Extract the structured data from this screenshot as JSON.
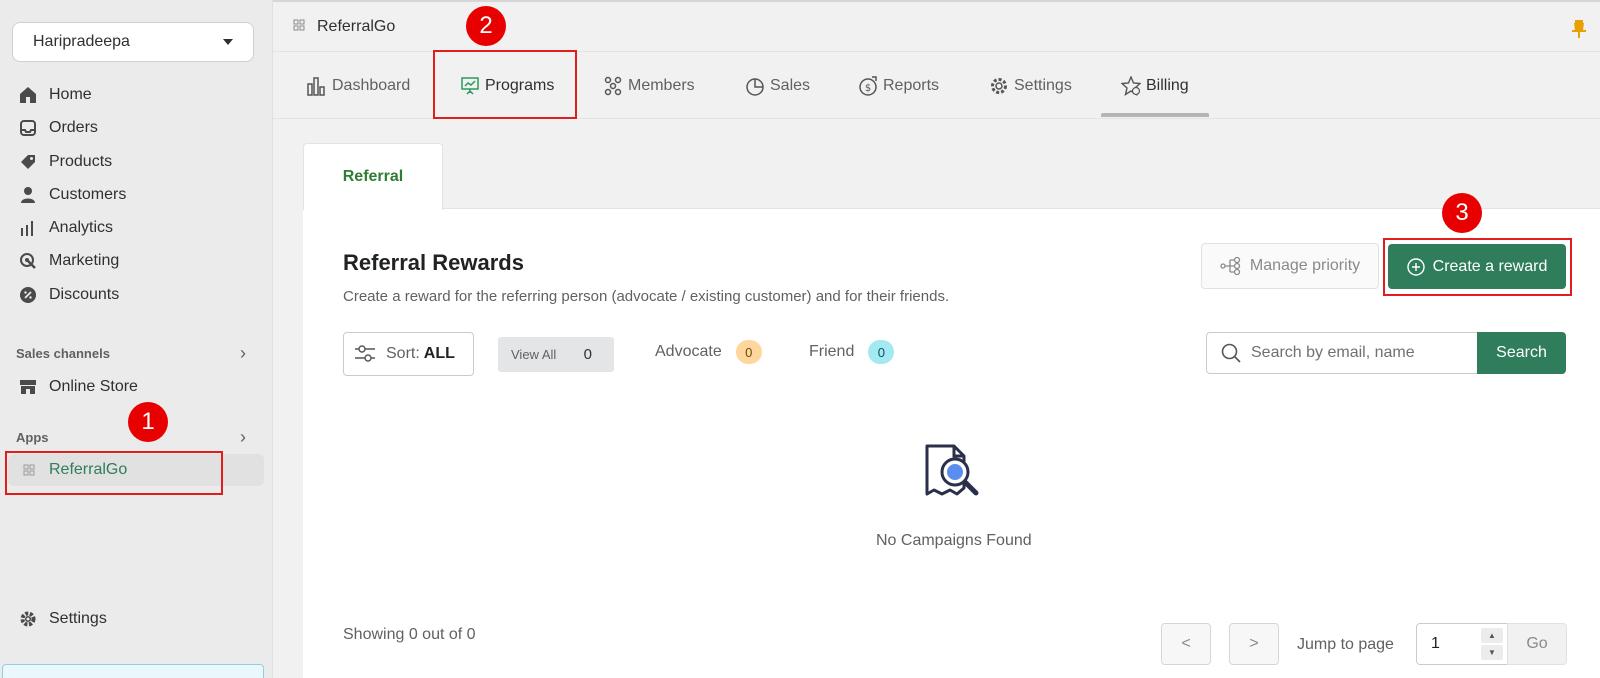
{
  "store": {
    "name": "Haripradeepa"
  },
  "sidebar": {
    "items": [
      {
        "label": "Home",
        "icon": "home-icon"
      },
      {
        "label": "Orders",
        "icon": "inbox-icon"
      },
      {
        "label": "Products",
        "icon": "tag-icon"
      },
      {
        "label": "Customers",
        "icon": "person-icon"
      },
      {
        "label": "Analytics",
        "icon": "bar-chart-icon"
      },
      {
        "label": "Marketing",
        "icon": "target-icon"
      },
      {
        "label": "Discounts",
        "icon": "discount-icon"
      }
    ],
    "sales_channels_label": "Sales channels",
    "online_store_label": "Online Store",
    "apps_label": "Apps",
    "app_item_label": "ReferralGo",
    "settings_label": "Settings"
  },
  "topbar": {
    "app_title": "ReferralGo"
  },
  "tabs": [
    {
      "label": "Dashboard",
      "icon": "bar-chart-icon"
    },
    {
      "label": "Programs",
      "icon": "presentation-icon"
    },
    {
      "label": "Members",
      "icon": "members-icon"
    },
    {
      "label": "Sales",
      "icon": "pie-chart-icon"
    },
    {
      "label": "Reports",
      "icon": "reports-icon"
    },
    {
      "label": "Settings",
      "icon": "gear-icon"
    },
    {
      "label": "Billing",
      "icon": "star-icon"
    }
  ],
  "subtab": {
    "label": "Referral"
  },
  "main": {
    "title": "Referral Rewards",
    "subtitle": "Create a reward for the referring person (advocate / existing customer) and for their friends.",
    "manage_priority_label": "Manage priority",
    "create_reward_label": "Create a reward",
    "sort_label": "Sort:",
    "sort_value": "ALL",
    "view_all_label": "View All",
    "view_all_count": "0",
    "advocate_label": "Advocate",
    "advocate_count": "0",
    "friend_label": "Friend",
    "friend_count": "0",
    "search_placeholder": "Search by email, name",
    "search_button_label": "Search",
    "empty_text": "No Campaigns Found",
    "showing_text": "Showing 0 out of 0",
    "prev_label": "<",
    "next_label": ">",
    "jump_label": "Jump to page",
    "jump_value": "1",
    "go_label": "Go"
  },
  "annotations": {
    "one": "1",
    "two": "2",
    "three": "3"
  },
  "colors": {
    "accent": "#2f7d5b",
    "annotation": "#e01e1e",
    "subtab_text": "#2e7d32"
  }
}
